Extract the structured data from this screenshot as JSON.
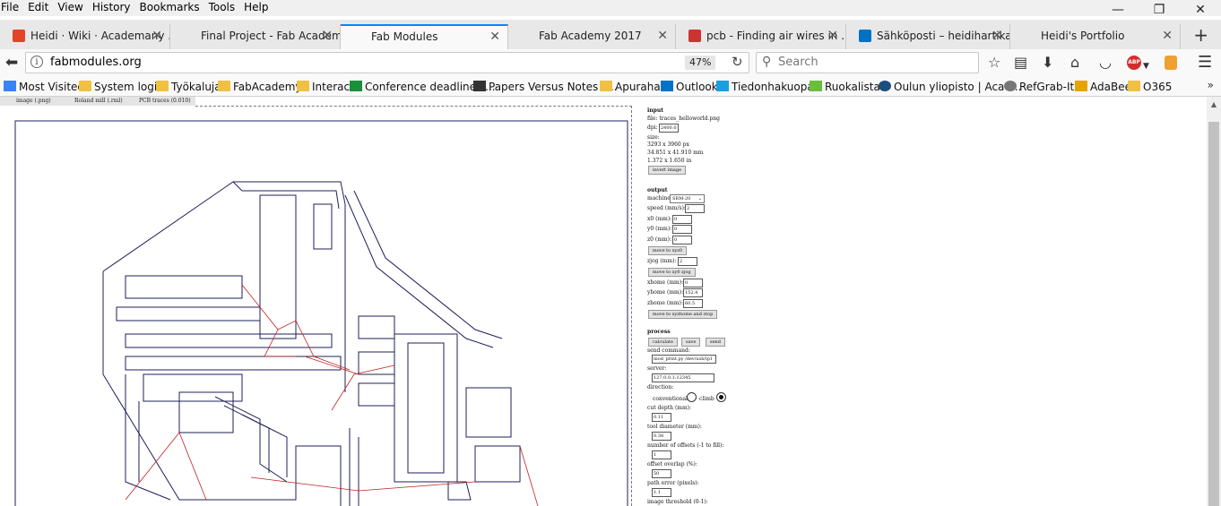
{
  "menu": [
    "File",
    "Edit",
    "View",
    "History",
    "Bookmarks",
    "Tools",
    "Help"
  ],
  "window_controls": {
    "minimize": "—",
    "restore": "❐",
    "close": "✕"
  },
  "tabs": [
    {
      "label": "Heidi · Wiki · Academany ...",
      "icon_color": "#e24329",
      "active": false
    },
    {
      "label": "Final Project - Fab Academy 2...",
      "icon_color": "",
      "active": false
    },
    {
      "label": "Fab Modules",
      "icon_color": "",
      "active": true
    },
    {
      "label": "Fab Academy 2017",
      "icon_color": "",
      "active": false
    },
    {
      "label": "pcb - Finding air wires in ...",
      "icon_color": "#cc3333",
      "active": false
    },
    {
      "label": "Sähköposti – heidihartikai...",
      "icon_color": "#0072c6",
      "active": false
    },
    {
      "label": "Heidi's Portfolio",
      "icon_color": "",
      "active": false
    }
  ],
  "address": {
    "url": "fabmodules.org",
    "zoom": "47%",
    "search_placeholder": "Search"
  },
  "bookmarks": [
    {
      "label": "Most Visited",
      "icon": "star-folder-icon",
      "color": "#3b82f6"
    },
    {
      "label": "System login",
      "icon": "folder-icon",
      "color": "#f0c040"
    },
    {
      "label": "Työkaluja",
      "icon": "folder-icon",
      "color": "#f0c040"
    },
    {
      "label": "FabAcademy",
      "icon": "folder-icon",
      "color": "#f0c040"
    },
    {
      "label": "Interact",
      "icon": "folder-icon",
      "color": "#f0c040"
    },
    {
      "label": "Conference deadlines ...",
      "icon": "grid-icon",
      "color": "#1a8f3c"
    },
    {
      "label": "Papers Versus Notes –...",
      "icon": "logo-icon",
      "color": "#333333"
    },
    {
      "label": "Apurahat",
      "icon": "folder-icon",
      "color": "#f0c040"
    },
    {
      "label": "Outlook",
      "icon": "outlook-icon",
      "color": "#0072c6"
    },
    {
      "label": "Tiedonhakuopas",
      "icon": "book-icon",
      "color": "#1aa0e0"
    },
    {
      "label": "Ruokalistat",
      "icon": "leaf-icon",
      "color": "#6abf3a"
    },
    {
      "label": "Oulun yliopisto | Acad...",
      "icon": "globe-icon",
      "color": "#1c4e80"
    },
    {
      "label": "RefGrab-It",
      "icon": "globe-icon",
      "color": "#777777"
    },
    {
      "label": "AdaBee",
      "icon": "bee-icon",
      "color": "#e6a400"
    },
    {
      "label": "O365",
      "icon": "folder-icon",
      "color": "#f0c040"
    }
  ],
  "fabmodules": {
    "tabs": [
      "image (.png)",
      "Roland mill (.rml)",
      "PCB traces (0.010)"
    ],
    "input": {
      "header": "input",
      "file": "file: traces_helloworld.png",
      "dpi_label": "dpi:",
      "dpi_value": "2400.02",
      "size_label": "size:",
      "size_px": "3293 x 3960 px",
      "size_mm": "34.851 x 41.910 mm",
      "size_in": "1.372 x 1.650 in",
      "invert_button": "invert image"
    },
    "output": {
      "header": "output",
      "machine_label": "machine:",
      "machine_value": "SRM-20",
      "speed_label": "speed (mm/s):",
      "speed_value": "2",
      "x0_label": "x0 (mm):",
      "x0_value": "0",
      "y0_label": "y0 (mm):",
      "y0_value": "0",
      "z0_label": "z0 (mm):",
      "z0_value": "0",
      "move_xyz0_button": "move to xyz0",
      "zjog_label": "zjog (mm):",
      "zjog_value": "2",
      "move_zjog_button": "move to xy0 zjog",
      "xhome_label": "xhome (mm):",
      "xhome_value": "0",
      "yhome_label": "yhome (mm):",
      "yhome_value": "152.4",
      "zhome_label": "zhome (mm):",
      "zhome_value": "60.5",
      "move_home_button": "move to xyzhome and stop"
    },
    "process": {
      "header": "process",
      "calculate_button": "calculate",
      "save_button": "save",
      "send_button": "send",
      "send_command_label": "send command:",
      "send_command_value": "mod_print.py /dev/usb/lp1",
      "server_label": "server:",
      "server_value": "127.0.0.1:12345",
      "direction_label": "direction:",
      "conventional_label": "conventional",
      "climb_label": "climb",
      "direction_selected": "climb",
      "cut_depth_label": "cut depth (mm):",
      "cut_depth_value": "0.11",
      "tool_diameter_label": "tool diameter (mm):",
      "tool_diameter_value": "0.38",
      "offsets_label": "number of offsets (-1 to fill):",
      "offsets_value": "1",
      "overlap_label": "offset overlap (%):",
      "overlap_value": "50",
      "path_error_label": "path error (pixels):",
      "path_error_value": "1.1",
      "threshold_label": "image threshold (0-1):"
    }
  }
}
